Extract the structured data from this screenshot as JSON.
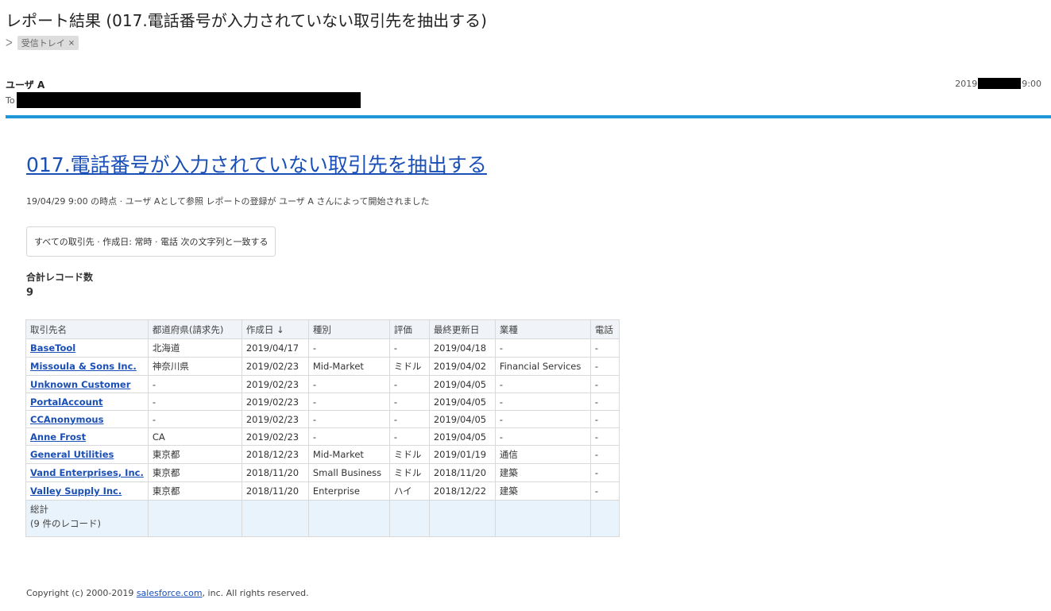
{
  "email": {
    "subject": "レポート結果 (017.電話番号が入力されていない取引先を抽出する)",
    "label": "受信トレイ",
    "label_close": "×",
    "label_arrow_icon": "label-arrow-icon",
    "sender": "ユーザ A",
    "to_label": "To",
    "date_prefix": "2019",
    "date_suffix": "9:00",
    "accent_color": "#1f97d8"
  },
  "report": {
    "title": "017.電話番号が入力されていない取引先を抽出する",
    "meta": "19/04/29 9:00 の時点 · ユーザ Aとして参照 レポートの登録が ユーザ A さんによって開始されました",
    "filter": "すべての取引先 · 作成日: 常時 · 電話 次の文字列と一致する",
    "total_label": "合計レコード数",
    "total_value": "9",
    "columns": [
      "取引先名",
      "都道府県(請求先)",
      "作成日 ↓",
      "種別",
      "評価",
      "最終更新日",
      "業種",
      "電話"
    ],
    "rows": [
      [
        "BaseTool",
        "北海道",
        "2019/04/17",
        "-",
        "-",
        "2019/04/18",
        "-",
        "-"
      ],
      [
        "Missoula & Sons Inc.",
        "神奈川県",
        "2019/02/23",
        "Mid-Market",
        "ミドル",
        "2019/04/02",
        "Financial Services",
        "-"
      ],
      [
        "Unknown Customer",
        "-",
        "2019/02/23",
        "-",
        "-",
        "2019/04/05",
        "-",
        "-"
      ],
      [
        "PortalAccount",
        "-",
        "2019/02/23",
        "-",
        "-",
        "2019/04/05",
        "-",
        "-"
      ],
      [
        "CCAnonymous",
        "-",
        "2019/02/23",
        "-",
        "-",
        "2019/04/05",
        "-",
        "-"
      ],
      [
        "Anne Frost",
        "CA",
        "2019/02/23",
        "-",
        "-",
        "2019/04/05",
        "-",
        "-"
      ],
      [
        "General Utilities",
        "東京都",
        "2018/12/23",
        "Mid-Market",
        "ミドル",
        "2019/01/19",
        "通信",
        "-"
      ],
      [
        "Vand Enterprises, Inc.",
        "東京都",
        "2018/11/20",
        "Small Business",
        "ミドル",
        "2018/11/20",
        "建築",
        "-"
      ],
      [
        "Valley Supply Inc.",
        "東京都",
        "2018/11/20",
        "Enterprise",
        "ハイ",
        "2018/12/22",
        "建築",
        "-"
      ]
    ],
    "grand_total": "総計",
    "grand_total_sub": "(9 件のレコード)"
  },
  "footer": {
    "prefix": "Copyright (c) 2000-2019 ",
    "link": "salesforce.com",
    "suffix": ", inc. All rights reserved."
  }
}
